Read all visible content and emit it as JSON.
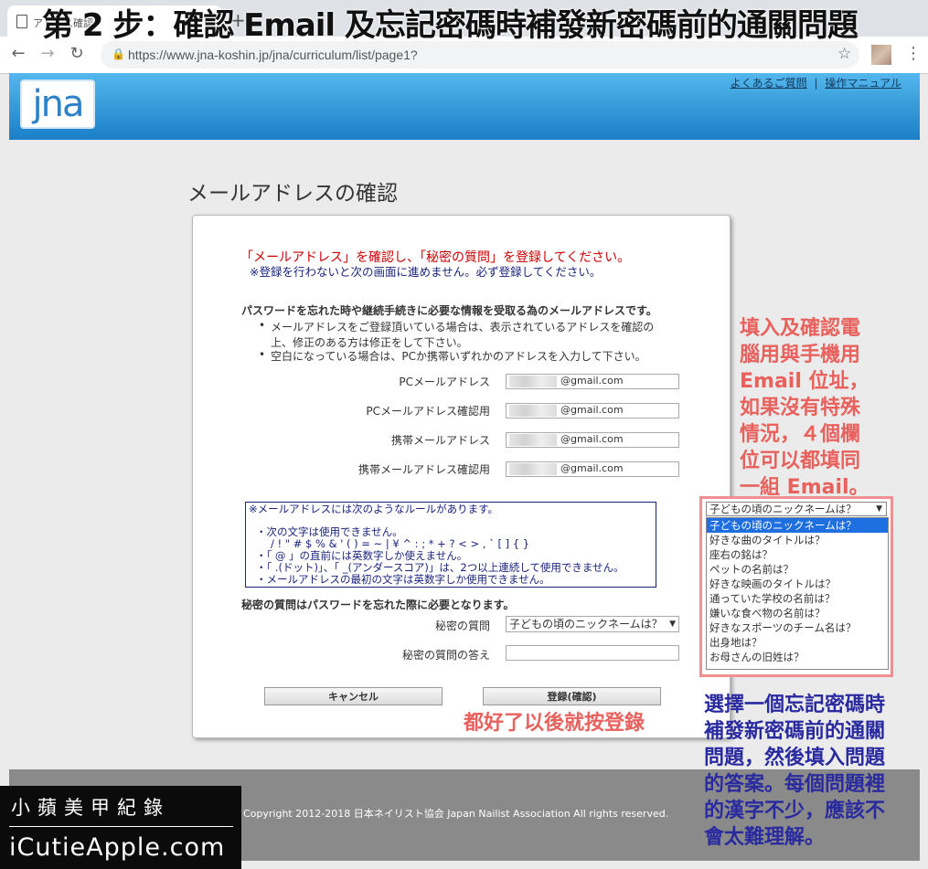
{
  "browser": {
    "tab_title": "アドレス確認",
    "tab_close": "×",
    "new_tab": "+",
    "back": "←",
    "forward": "→",
    "reload": "↻",
    "lock": "🔒",
    "url": "https://www.jna-koshin.jp/jna/curriculum/list/page1?",
    "star": "☆",
    "menu": "⋮"
  },
  "overlay_title": "第 2 步：確認 Email 及忘記密碼時補發新密碼前的通關問題",
  "site": {
    "logo": "jna",
    "faq_link": "よくあるご質問",
    "separator": "|",
    "manual_link": "操作マニュアル"
  },
  "page_title": "メールアドレスの確認",
  "card": {
    "notice_red": "「メールアドレス」を確認し、「秘密の質問」を登録してください。",
    "notice_blue": "※登録を行わないと次の画面に進めません。必ず登録してください。",
    "intro": "パスワードを忘れた時や継続手続きに必要な情報を受取る為のメールアドレスです。",
    "bullet1_line1": "メールアドレスをご登録頂いている場合は、表示されているアドレスを確認の",
    "bullet1_line2": "上、修正のある方は修正をして下さい。",
    "bullet2": "空白になっている場合は、PCか携帯いずれかのアドレスを入力して下さい。",
    "fields": [
      {
        "label": "PCメールアドレス",
        "value": "@gmail.com"
      },
      {
        "label": "PCメールアドレス確認用",
        "value": "@gmail.com"
      },
      {
        "label": "携帯メールアドレス",
        "value": "@gmail.com"
      },
      {
        "label": "携帯メールアドレス確認用",
        "value": "@gmail.com"
      }
    ],
    "rules": {
      "title": "※メールアドレスには次のようなルールがあります。",
      "line1": "・次の文字は使用できません。",
      "line2": "/ ! \" # $ % & ' ( ) = ~ | ¥ ^ : ; * + ? < > , ` [ ] { }",
      "line3": "・「 @ 」の直前には英数字しか使えません。",
      "line4": "・「 .(ドット)」、「 _(アンダースコア)」は、2つ以上連続して使用できません。",
      "line5": "・メールアドレスの最初の文字は英数字しか使用できません。"
    },
    "secret_intro": "秘密の質問はパスワードを忘れた際に必要となります。",
    "secret_question_label": "秘密の質問",
    "secret_question_value": "子どもの頃のニックネームは？",
    "secret_answer_label": "秘密の質問の答え",
    "secret_answer_value": "",
    "cancel_button": "キャンセル",
    "register_button": "登録(確認)"
  },
  "dropdown": {
    "selected": "子どもの頃のニックネームは？",
    "options": [
      "子どもの頃のニックネームは？",
      "好きな曲のタイトルは？",
      "座右の銘は？",
      "ペットの名前は？",
      "好きな映画のタイトルは？",
      "通っていた学校の名前は？",
      "嫌いな食べ物の名前は？",
      "好きなスポーツのチーム名は？",
      "出身地は？",
      "お母さんの旧姓は？"
    ]
  },
  "annotations": {
    "note1": [
      "填入及確認電",
      "腦用與手機用",
      "Email 位址，",
      "如果沒有特殊",
      "情況，４個欄",
      "位可以都填同",
      "一組 Email。"
    ],
    "note2": "都好了以後就按登錄",
    "note3": [
      "選擇一個忘記密碼時",
      "補發新密碼前的通關",
      "問題，然後填入問題",
      "的答案。每個問題裡",
      "的漢字不少，應該不",
      "會太難理解。"
    ]
  },
  "footer": {
    "copyright": "Copyright 2012-2018 日本ネイリスト協会 Japan Nailist Association All rights reserved."
  },
  "brand": {
    "line1": "小蘋美甲紀錄",
    "line2": "iCutieApple.com"
  },
  "colors": {
    "header_blue": "#1a7fc8",
    "notice_red": "#cc0000",
    "annotation_red": "#e8615d",
    "annotation_blue": "#2a2aa0",
    "select_blue": "#1e6fe0"
  }
}
